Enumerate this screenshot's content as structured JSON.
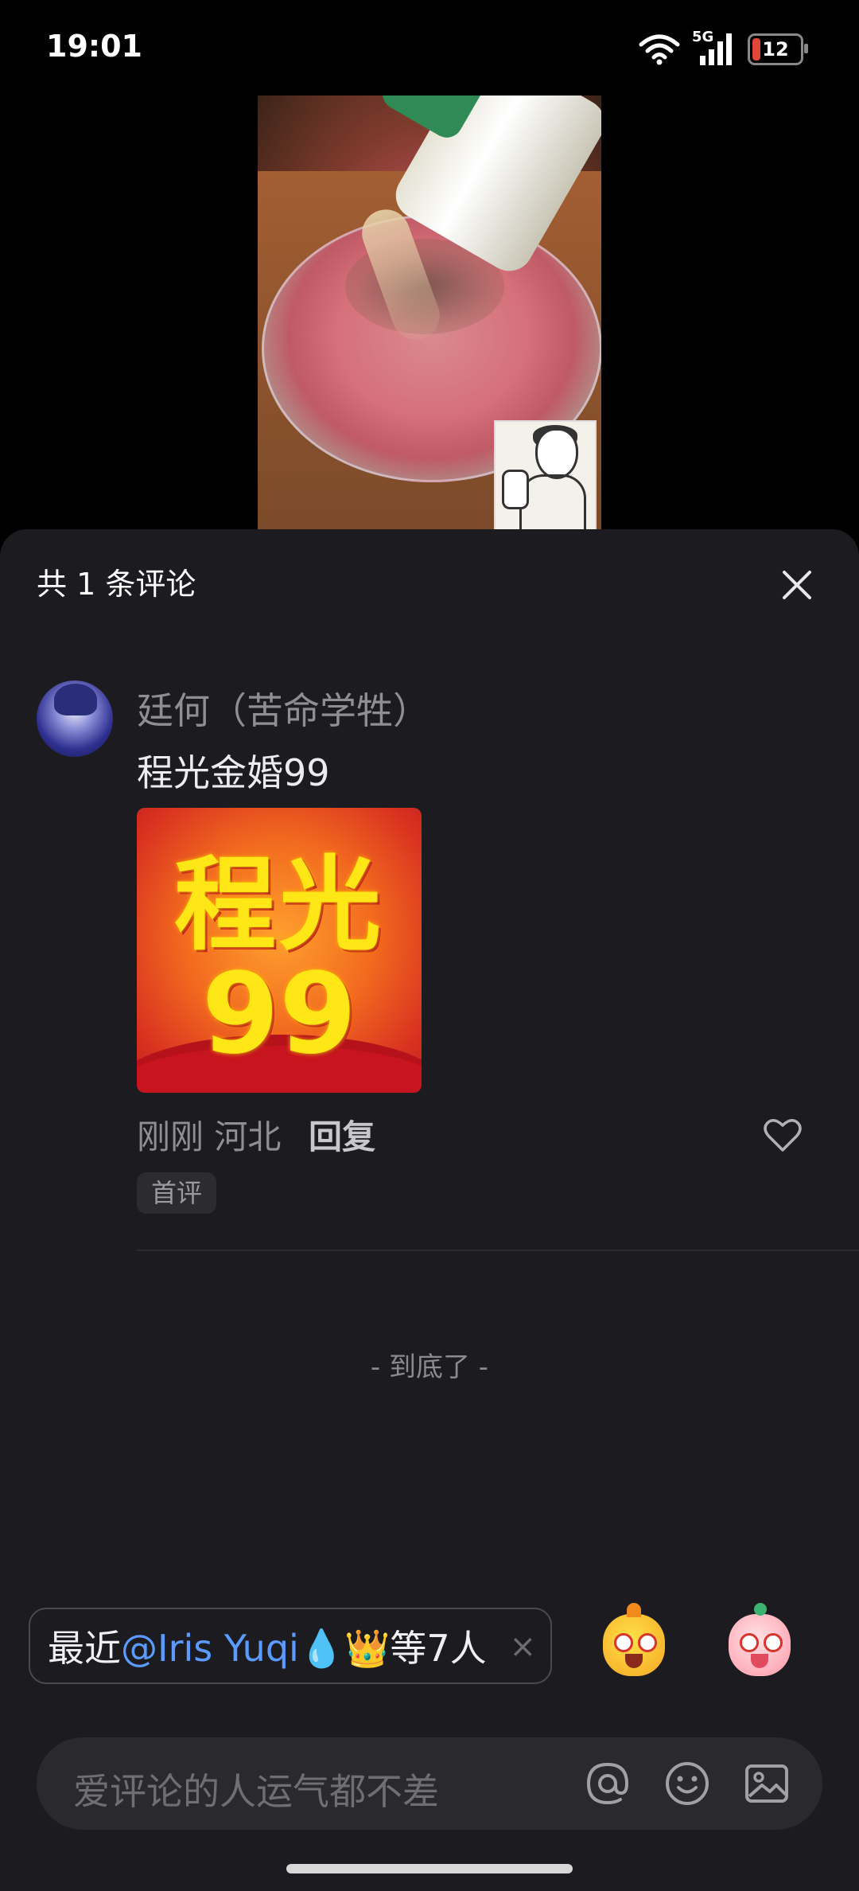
{
  "status_bar": {
    "time": "19:01",
    "network": "5G",
    "battery": "12"
  },
  "sheet": {
    "title": "共 1 条评论",
    "close_icon": "close-icon"
  },
  "comment": {
    "author": "廷何（苦命学牲）",
    "text": "程光金婚99",
    "sticker": {
      "line1": "程光",
      "line2": "99"
    },
    "meta": "刚刚 河北",
    "reply_label": "回复",
    "badge": "首评",
    "like_icon": "heart-outline-icon"
  },
  "end_marker": "- 到底了 -",
  "suggestion": {
    "prefix": "最近",
    "mention": "@Iris Yuqi",
    "emojis_inline": "💧👑",
    "suffix": "等7人",
    "close": "×"
  },
  "input": {
    "placeholder": "爱评论的人运气都不差",
    "icons": [
      "at-icon",
      "emoji-icon",
      "image-icon"
    ]
  },
  "colors": {
    "sheet_bg": "#1c1c20",
    "mention_blue": "#5b9bff",
    "input_bg": "#2a2a2e"
  }
}
